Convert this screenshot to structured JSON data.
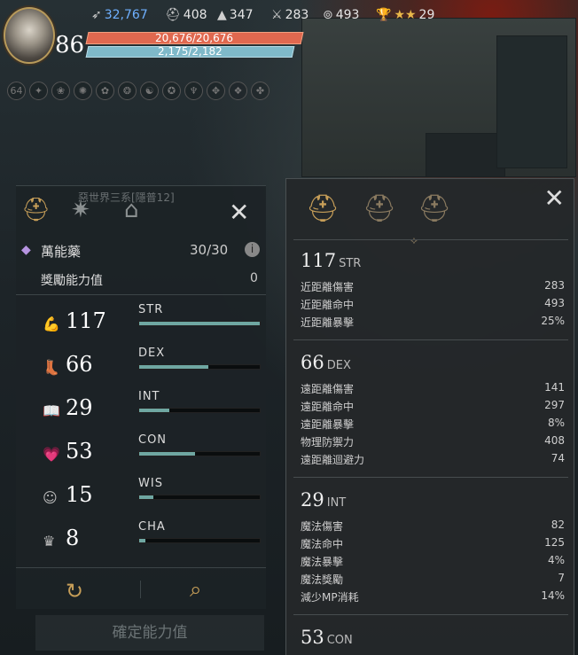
{
  "player": {
    "level": "86",
    "hp": "20,676/20,676",
    "mp": "2,175/2,182"
  },
  "resources": [
    {
      "icon": "feather-icon",
      "value": "32,767",
      "color": "#6fb0ff"
    },
    {
      "icon": "helmet-icon",
      "value": "408"
    },
    {
      "icon": "hat-icon",
      "value": "347"
    },
    {
      "icon": "sword-icon",
      "value": "283"
    },
    {
      "icon": "ring-icon",
      "value": "493"
    },
    {
      "icon": "trophy-icon",
      "value": "29"
    }
  ],
  "buffs": {
    "count": "64"
  },
  "left_panel": {
    "potion_name": "萬能藥",
    "potion_count": "30/30",
    "reward_label": "獎勵能力值",
    "reward_value": "0",
    "bg_text": "惡世界三系[隱普12]",
    "stats": [
      {
        "icon": "arm-icon",
        "value": "117",
        "name": "STR",
        "level": 1.0
      },
      {
        "icon": "boot-icon",
        "value": "66",
        "name": "DEX",
        "level": 0.57
      },
      {
        "icon": "book-icon",
        "value": "29",
        "name": "INT",
        "level": 0.25
      },
      {
        "icon": "heart-icon",
        "value": "53",
        "name": "CON",
        "level": 0.46
      },
      {
        "icon": "head-icon",
        "value": "15",
        "name": "WIS",
        "level": 0.12
      },
      {
        "icon": "crown-icon",
        "value": "8",
        "name": "CHA",
        "level": 0.05
      }
    ],
    "confirm_label": "確定能力值"
  },
  "right_panel": {
    "sections": [
      {
        "value": "117",
        "stat": "STR",
        "rows": [
          [
            "近距離傷害",
            "283"
          ],
          [
            "近距離命中",
            "493"
          ],
          [
            "近距離暴擊",
            "25%"
          ]
        ]
      },
      {
        "value": "66",
        "stat": "DEX",
        "rows": [
          [
            "遠距離傷害",
            "141"
          ],
          [
            "遠距離命中",
            "297"
          ],
          [
            "遠距離暴擊",
            "8%"
          ],
          [
            "物理防禦力",
            "408"
          ],
          [
            "遠距離迴避力",
            "74"
          ]
        ]
      },
      {
        "value": "29",
        "stat": "INT",
        "rows": [
          [
            "魔法傷害",
            "82"
          ],
          [
            "魔法命中",
            "125"
          ],
          [
            "魔法暴擊",
            "4%"
          ],
          [
            "魔法獎勵",
            "7"
          ],
          [
            "減少MP消耗",
            "14%"
          ]
        ]
      },
      {
        "value": "53",
        "stat": "CON",
        "rows": []
      }
    ]
  },
  "colors": {
    "accent": "#c69e58",
    "hp": "#e0684f",
    "mp": "#7fb9c9",
    "stat_fill": "#6fa7a2"
  }
}
